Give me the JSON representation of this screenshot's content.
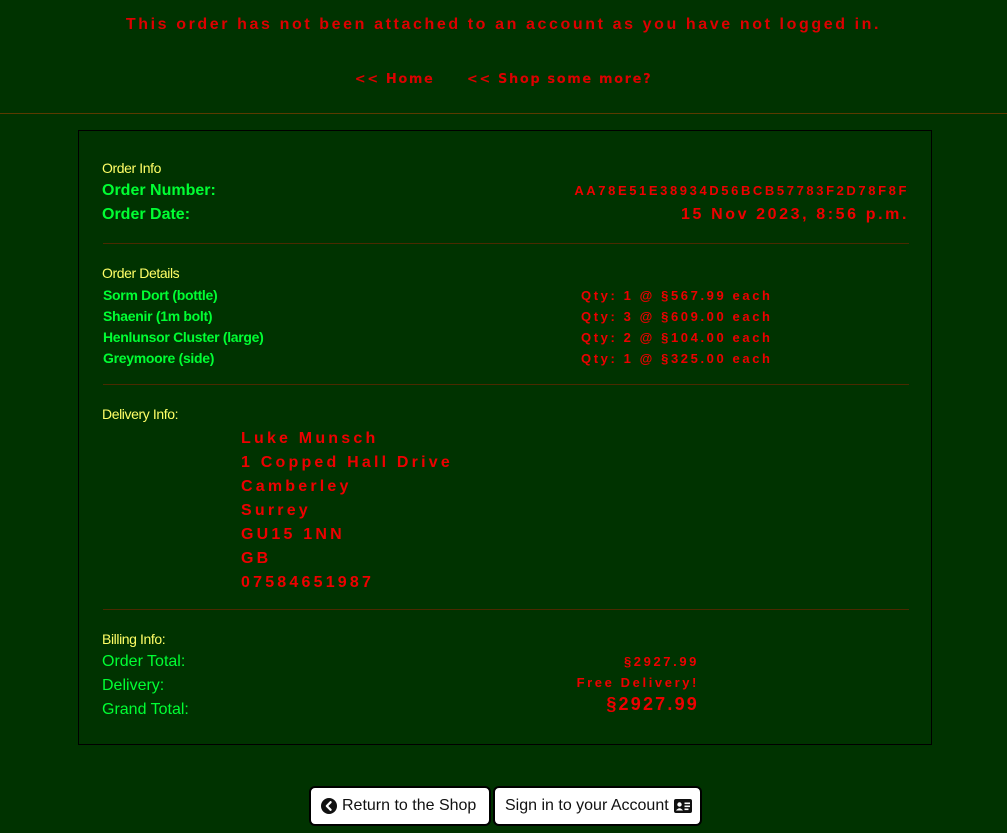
{
  "notice": "This order has not been attached to an account as you have not logged in.",
  "nav": {
    "home": "<< Home",
    "shop_more": "<< Shop some more?"
  },
  "order_info": {
    "heading": "Order Info",
    "number_label": "Order Number:",
    "number_value": "AA78E51E38934D56BCB57783F2D78F8F",
    "date_label": "Order Date:",
    "date_value": "15 Nov 2023, 8:56 p.m."
  },
  "order_details": {
    "heading": "Order Details",
    "items": [
      {
        "name": "Sorm Dort (bottle)",
        "qty": "Qty: 1 @ §567.99 each"
      },
      {
        "name": "Shaenir (1m bolt)",
        "qty": "Qty: 3 @ §609.00 each"
      },
      {
        "name": "Henlunsor Cluster (large)",
        "qty": "Qty: 2 @ §104.00 each"
      },
      {
        "name": "Greymoore (side)",
        "qty": "Qty: 1 @ §325.00 each"
      }
    ]
  },
  "delivery": {
    "heading": "Delivery Info:",
    "lines": [
      "Luke Munsch",
      "1 Copped Hall Drive",
      "Camberley",
      "Surrey",
      "GU15 1NN",
      "GB",
      "07584651987"
    ]
  },
  "billing": {
    "heading": "Billing Info:",
    "order_total_label": "Order Total:",
    "order_total_value": "§2927.99",
    "delivery_label": "Delivery:",
    "delivery_value": "Free Delivery!",
    "grand_total_label": "Grand Total:",
    "grand_total_value": "§2927.99"
  },
  "buttons": {
    "return_shop": "Return to the Shop",
    "sign_in": "Sign in to your Account"
  },
  "icons": {
    "return_shop": "chevron-circle-left-icon",
    "sign_in": "id-card-icon"
  },
  "colors": {
    "background": "#003300",
    "accent_red": "#ee0000",
    "label_green": "#00ff33",
    "heading_yellow": "#ffff66"
  }
}
